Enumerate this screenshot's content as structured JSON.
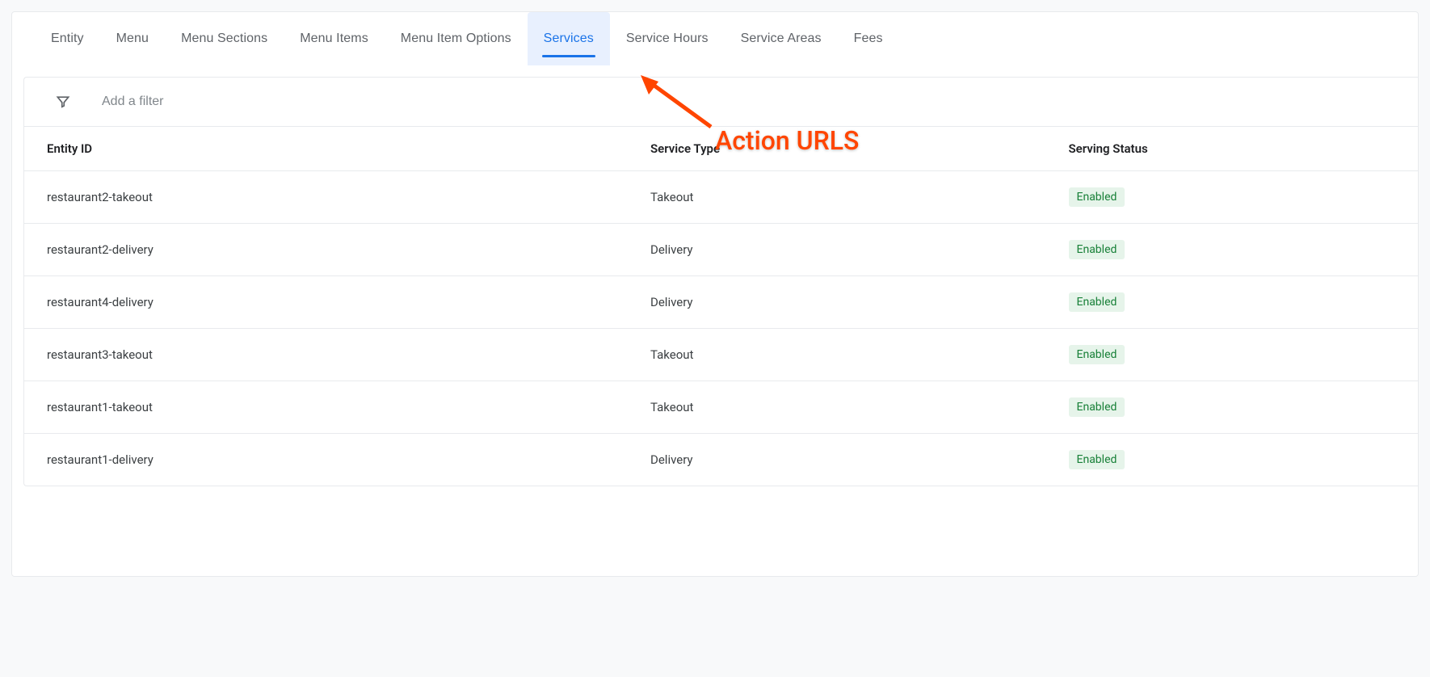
{
  "tabs": [
    {
      "label": "Entity",
      "active": false
    },
    {
      "label": "Menu",
      "active": false
    },
    {
      "label": "Menu Sections",
      "active": false
    },
    {
      "label": "Menu Items",
      "active": false
    },
    {
      "label": "Menu Item Options",
      "active": false
    },
    {
      "label": "Services",
      "active": true
    },
    {
      "label": "Service Hours",
      "active": false
    },
    {
      "label": "Service Areas",
      "active": false
    },
    {
      "label": "Fees",
      "active": false
    }
  ],
  "filter": {
    "placeholder": "Add a filter",
    "value": ""
  },
  "columns": {
    "entity_id": "Entity ID",
    "service_type": "Service Type",
    "serving_status": "Serving Status"
  },
  "rows": [
    {
      "entity_id": "restaurant2-takeout",
      "service_type": "Takeout",
      "serving_status": "Enabled"
    },
    {
      "entity_id": "restaurant2-delivery",
      "service_type": "Delivery",
      "serving_status": "Enabled"
    },
    {
      "entity_id": "restaurant4-delivery",
      "service_type": "Delivery",
      "serving_status": "Enabled"
    },
    {
      "entity_id": "restaurant3-takeout",
      "service_type": "Takeout",
      "serving_status": "Enabled"
    },
    {
      "entity_id": "restaurant1-takeout",
      "service_type": "Takeout",
      "serving_status": "Enabled"
    },
    {
      "entity_id": "restaurant1-delivery",
      "service_type": "Delivery",
      "serving_status": "Enabled"
    }
  ],
  "annotation": {
    "text": "Action URLS"
  }
}
